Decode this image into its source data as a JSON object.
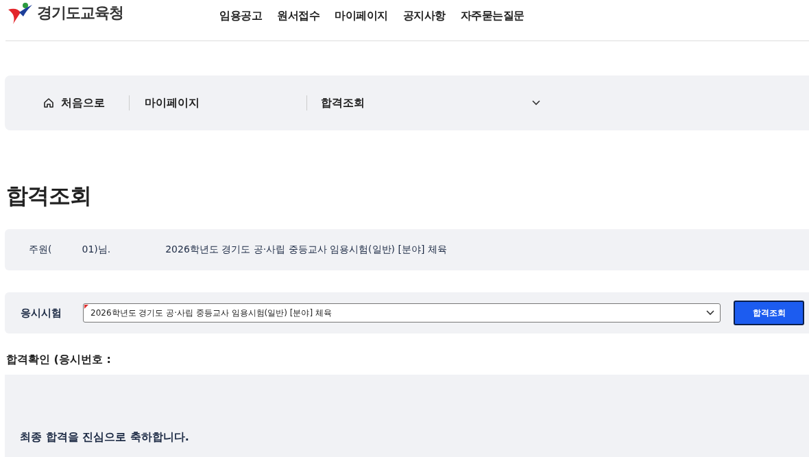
{
  "header": {
    "logo_text": "경기도교육청",
    "nav": [
      {
        "label": "임용공고"
      },
      {
        "label": "원서접수"
      },
      {
        "label": "마이페이지"
      },
      {
        "label": "공지사항"
      },
      {
        "label": "자주묻는질문"
      }
    ]
  },
  "breadcrumb": {
    "home": "처음으로",
    "level1": "마이페이지",
    "level2": "합격조회"
  },
  "page_title": "합격조회",
  "applicant": {
    "name_start": "주원(",
    "name_end": "01)님.",
    "exam": "2026학년도 경기도 공·사립 중등교사 임용시험(일반) [분야] 체육"
  },
  "search": {
    "label": "응시시험",
    "value": "2026학년도 경기도 공·사립 중등교사 임용시험(일반) [분야] 체육",
    "button": "합격조회"
  },
  "result": {
    "heading": "합격확인 (응시번호 :",
    "message": "최종 합격을 진심으로 축하합니다."
  }
}
